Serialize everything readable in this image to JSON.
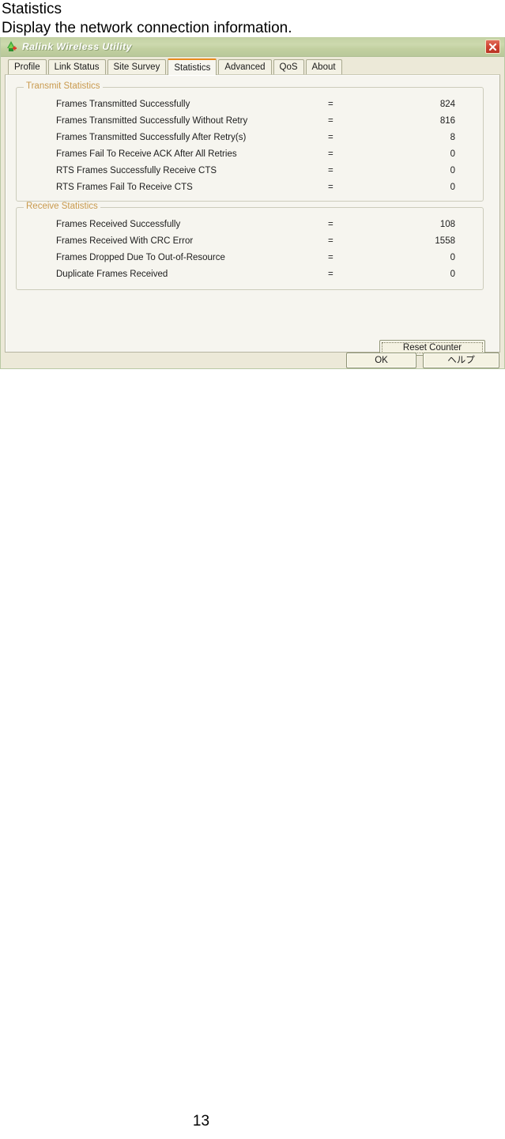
{
  "document": {
    "heading": "Statistics",
    "description": "Display the network connection information.",
    "page_number": "13"
  },
  "window": {
    "title": "Ralink Wireless Utility",
    "icon": "ralink-logo-icon",
    "close_label": "×",
    "colors": {
      "titlebar_green": "#c5d3a6",
      "dialog_face": "#ece9d8",
      "panel_face": "#f6f5ef",
      "accent_orange": "#e88a1e",
      "legend_text": "#c99a4e",
      "close_red": "#cf4433"
    }
  },
  "tabs": [
    {
      "label": "Profile",
      "active": false
    },
    {
      "label": "Link Status",
      "active": false
    },
    {
      "label": "Site Survey",
      "active": false
    },
    {
      "label": "Statistics",
      "active": true
    },
    {
      "label": "Advanced",
      "active": false
    },
    {
      "label": "QoS",
      "active": false
    },
    {
      "label": "About",
      "active": false
    }
  ],
  "groups": {
    "transmit": {
      "legend": "Transmit Statistics",
      "rows": [
        {
          "label": "Frames Transmitted Successfully",
          "eq": "=",
          "value": "824"
        },
        {
          "label": "Frames Transmitted Successfully  Without Retry",
          "eq": "=",
          "value": "816"
        },
        {
          "label": "Frames Transmitted Successfully After Retry(s)",
          "eq": "=",
          "value": "8"
        },
        {
          "label": "Frames Fail To Receive ACK After All Retries",
          "eq": "=",
          "value": "0"
        },
        {
          "label": "RTS Frames Successfully Receive CTS",
          "eq": "=",
          "value": "0"
        },
        {
          "label": "RTS Frames Fail To Receive CTS",
          "eq": "=",
          "value": "0"
        }
      ]
    },
    "receive": {
      "legend": "Receive Statistics",
      "rows": [
        {
          "label": "Frames Received Successfully",
          "eq": "=",
          "value": "108"
        },
        {
          "label": "Frames Received With CRC Error",
          "eq": "=",
          "value": "1558"
        },
        {
          "label": "Frames Dropped Due To Out-of-Resource",
          "eq": "=",
          "value": "0"
        },
        {
          "label": "Duplicate Frames Received",
          "eq": "=",
          "value": "0"
        }
      ]
    }
  },
  "buttons": {
    "reset_counter": "Reset Counter",
    "ok": "OK",
    "help": "ヘルプ"
  }
}
